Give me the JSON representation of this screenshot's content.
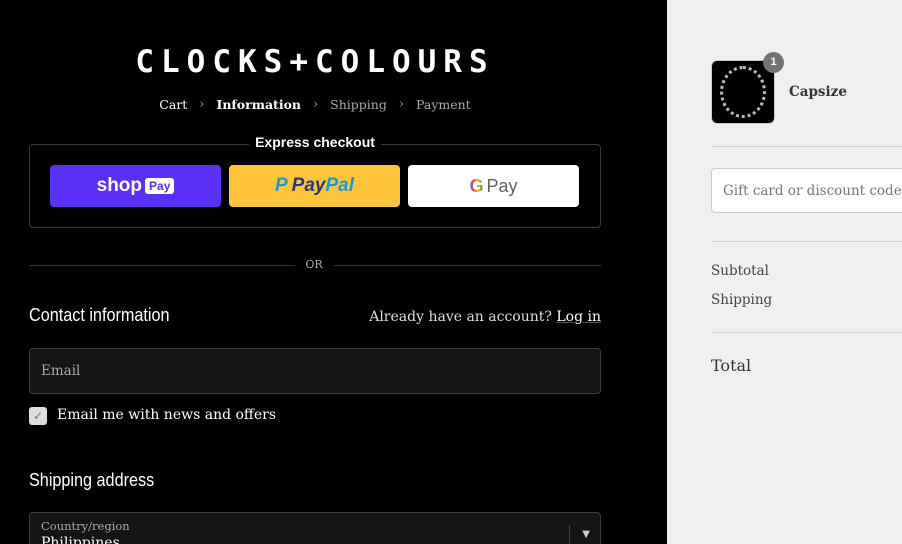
{
  "brand": {
    "logo_text": "CLOCKS+COLOURS"
  },
  "breadcrumb": {
    "items": [
      "Cart",
      "Information",
      "Shipping",
      "Payment"
    ],
    "separator": "›",
    "current": "Information"
  },
  "express": {
    "title": "Express checkout",
    "shop_pay": {
      "text": "shop",
      "badge": "Pay"
    },
    "paypal": {
      "text_a": "Pay",
      "text_b": "Pal",
      "icon": "P"
    },
    "google_pay": {
      "g": "G",
      "text": "Pay"
    }
  },
  "divider": {
    "text": "OR"
  },
  "contact": {
    "title": "Contact information",
    "account_prompt": "Already have an account?",
    "login_link": "Log in",
    "email_placeholder": "Email",
    "newsletter_label": "Email me with news and offers",
    "newsletter_checked": true
  },
  "shipping": {
    "title": "Shipping address",
    "country_label": "Country/region",
    "country_value": "Philippines"
  },
  "summary": {
    "product": {
      "name": "Capsize",
      "quantity": "1"
    },
    "discount_placeholder": "Gift card or discount code",
    "subtotal_label": "Subtotal",
    "shipping_label": "Shipping",
    "total_label": "Total"
  },
  "colors": {
    "shop_pay": "#5a31f4",
    "paypal": "#ffc439",
    "left_bg": "#000000",
    "right_bg": "#f0f0f0"
  }
}
